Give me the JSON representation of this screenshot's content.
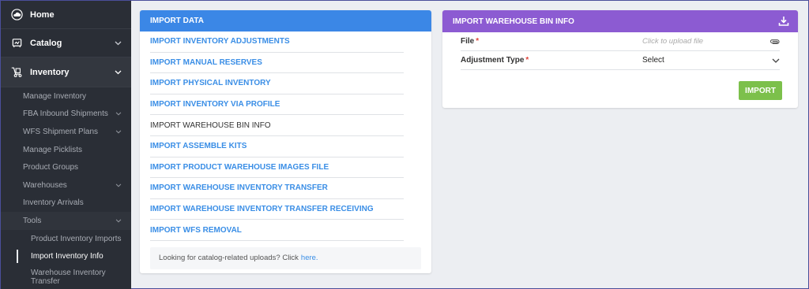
{
  "sidebar": {
    "home_label": "Home",
    "catalog_label": "Catalog",
    "inventory_label": "Inventory",
    "inventory_items": [
      {
        "label": "Manage Inventory"
      },
      {
        "label": "FBA Inbound Shipments"
      },
      {
        "label": "WFS Shipment Plans"
      },
      {
        "label": "Manage Picklists"
      },
      {
        "label": "Product Groups"
      },
      {
        "label": "Warehouses"
      },
      {
        "label": "Inventory Arrivals"
      },
      {
        "label": "Tools"
      }
    ],
    "tools_items": [
      {
        "label": "Product Inventory Imports"
      },
      {
        "label": "Import Inventory Info"
      },
      {
        "label": "Warehouse Inventory Transfer"
      }
    ]
  },
  "import_data": {
    "title": "IMPORT DATA",
    "links": [
      {
        "label": "IMPORT INVENTORY ADJUSTMENTS"
      },
      {
        "label": "IMPORT MANUAL RESERVES"
      },
      {
        "label": "IMPORT PHYSICAL INVENTORY"
      },
      {
        "label": "IMPORT INVENTORY VIA PROFILE"
      },
      {
        "label": "IMPORT WAREHOUSE BIN INFO"
      },
      {
        "label": "IMPORT ASSEMBLE KITS"
      },
      {
        "label": "IMPORT PRODUCT WAREHOUSE IMAGES FILE"
      },
      {
        "label": "IMPORT WAREHOUSE INVENTORY TRANSFER"
      },
      {
        "label": "IMPORT WAREHOUSE INVENTORY TRANSFER RECEIVING"
      },
      {
        "label": "IMPORT WFS REMOVAL"
      }
    ],
    "footer_text": "Looking for catalog-related uploads? Click",
    "footer_link": "here."
  },
  "bin_info": {
    "title": "IMPORT WAREHOUSE BIN INFO",
    "file_label": "File",
    "file_placeholder": "Click to upload file",
    "adjustment_label": "Adjustment Type",
    "adjustment_value": "Select",
    "required_mark": "*",
    "import_button": "IMPORT"
  },
  "colors": {
    "blue_header": "#3b87e6",
    "purple_header": "#8c5bd2",
    "import_button": "#7cc04b",
    "link": "#3a8ee6",
    "sidebar_bg": "#2a2e36"
  },
  "icons": {
    "home": "cloud-icon",
    "catalog": "catalog-icon",
    "inventory": "hand-truck-icon",
    "download": "download-icon",
    "attach": "paperclip-icon",
    "chevron": "chevron-down-icon"
  }
}
